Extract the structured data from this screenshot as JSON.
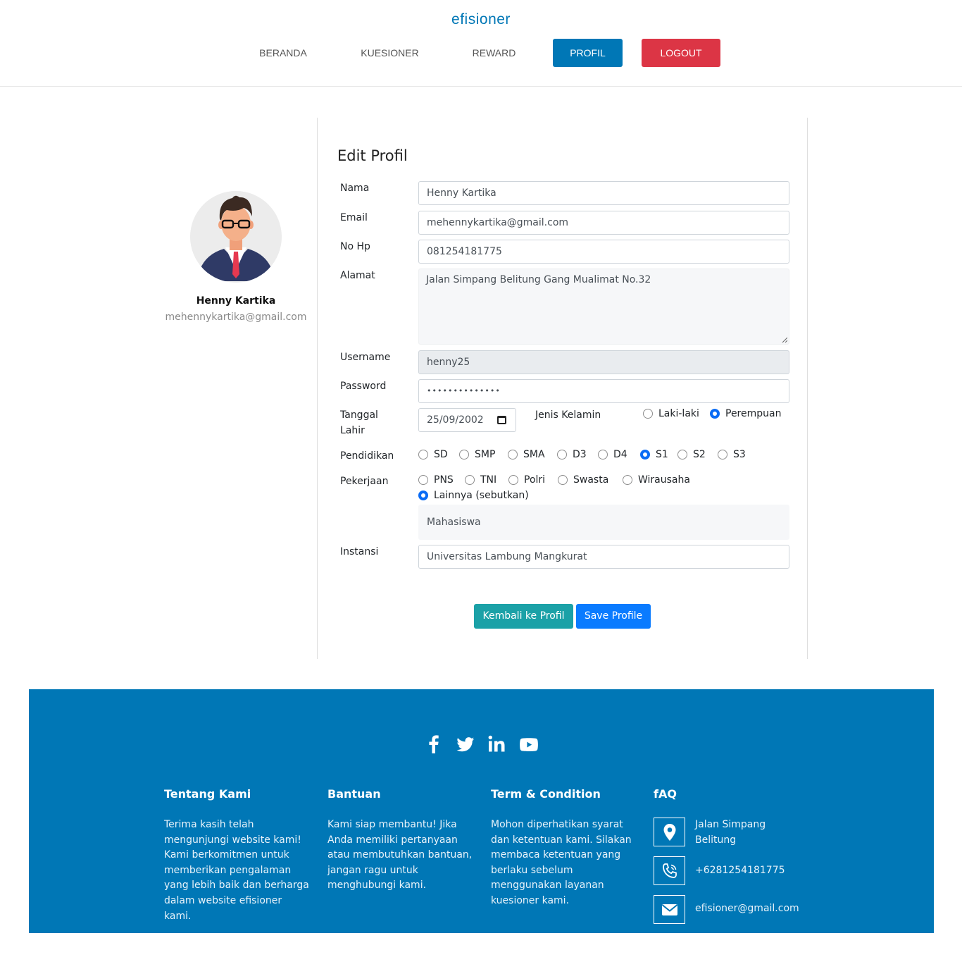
{
  "brand": "efisioner",
  "nav": {
    "beranda": "BERANDA",
    "kuesioner": "KUESIONER",
    "reward": "REWARD",
    "profil": "PROFIL",
    "logout": "LOGOUT"
  },
  "profile": {
    "name": "Henny Kartika",
    "email": "mehennykartika@gmail.com"
  },
  "form": {
    "title": "Edit Profil",
    "labels": {
      "nama": "Nama",
      "email": "Email",
      "nohp": "No Hp",
      "alamat": "Alamat",
      "username": "Username",
      "password": "Password",
      "tanggal_lahir": "Tanggal Lahir",
      "jenis_kelamin": "Jenis Kelamin",
      "pendidikan": "Pendidikan",
      "pekerjaan": "Pekerjaan",
      "instansi": "Instansi"
    },
    "values": {
      "nama": "Henny Kartika",
      "email": "mehennykartika@gmail.com",
      "nohp": "081254181775",
      "alamat": "Jalan Simpang Belitung Gang Mualimat No.32",
      "username": "henny25",
      "password": "••••••••••••••",
      "tanggal_lahir": "25/09/2002",
      "pekerjaan_lainnya": "Mahasiswa",
      "instansi": "Universitas Lambung Mangkurat"
    },
    "gender_options": [
      "Laki-laki",
      "Perempuan"
    ],
    "gender_selected": "Perempuan",
    "pendidikan_options": [
      "SD",
      "SMP",
      "SMA",
      "D3",
      "D4",
      "S1",
      "S2",
      "S3"
    ],
    "pendidikan_selected": "S1",
    "pekerjaan_options": [
      "PNS",
      "TNI",
      "Polri",
      "Swasta",
      "Wirausaha",
      "Lainnya (sebutkan)"
    ],
    "pekerjaan_selected": "Lainnya (sebutkan)",
    "buttons": {
      "back": "Kembali ke Profil",
      "save": "Save Profile"
    }
  },
  "footer": {
    "social_icons": [
      "facebook-icon",
      "twitter-icon",
      "linkedin-icon",
      "youtube-icon"
    ],
    "about": {
      "title": "Tentang Kami",
      "text": "Terima kasih telah mengunjungi website kami! Kami berkomitmen untuk memberikan pengalaman yang lebih baik dan berharga dalam website efisioner kami."
    },
    "help": {
      "title": "Bantuan",
      "text": "Kami siap membantu! Jika Anda memiliki pertanyaan atau membutuhkan bantuan, jangan ragu untuk menghubungi kami."
    },
    "terms": {
      "title": "Term & Condition",
      "text": "Mohon diperhatikan syarat dan ketentuan kami. Silakan membaca ketentuan yang berlaku sebelum menggunakan layanan kuesioner kami."
    },
    "faq": {
      "title": "fAQ",
      "address": "Jalan Simpang Belitung",
      "phone": "+6281254181775",
      "email": "efisioner@gmail.com"
    }
  },
  "colors": {
    "primary": "#0077b6",
    "danger": "#dc3545",
    "teal": "#1ba1a7",
    "save": "#0a7bff"
  }
}
